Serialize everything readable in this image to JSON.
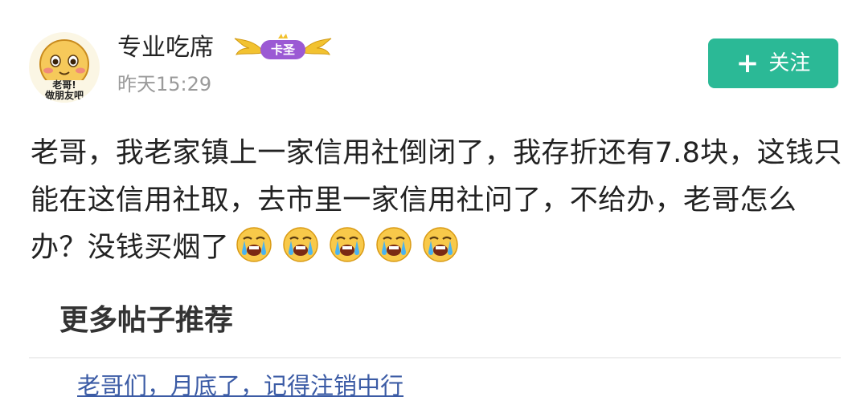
{
  "author": {
    "name": "专业吃席",
    "badge": "卡圣",
    "timestamp": "昨天15:29",
    "avatar_text_line1": "老哥!",
    "avatar_text_line2": "做朋友吧"
  },
  "follow_button": {
    "icon": "plus-icon",
    "label": "关注"
  },
  "post": {
    "text": "老哥，我老家镇上一家信用社倒闭了，我存折还有7.8块，这钱只能在这信用社取，去市里一家信用社问了，不给办，老哥怎么办？没钱买烟了",
    "emoji": [
      "crying-face-icon",
      "crying-face-icon",
      "crying-face-icon",
      "crying-face-icon",
      "crying-face-icon"
    ]
  },
  "recommendations": {
    "title": "更多帖子推荐",
    "items": [
      {
        "label": "老哥们，月底了，记得注销中行"
      }
    ]
  },
  "colors": {
    "accent": "#2bb996",
    "link": "#3b5ba5",
    "muted": "#9a9a9a",
    "badge_purple": "#9b59d4",
    "badge_gold": "#f2c230"
  }
}
